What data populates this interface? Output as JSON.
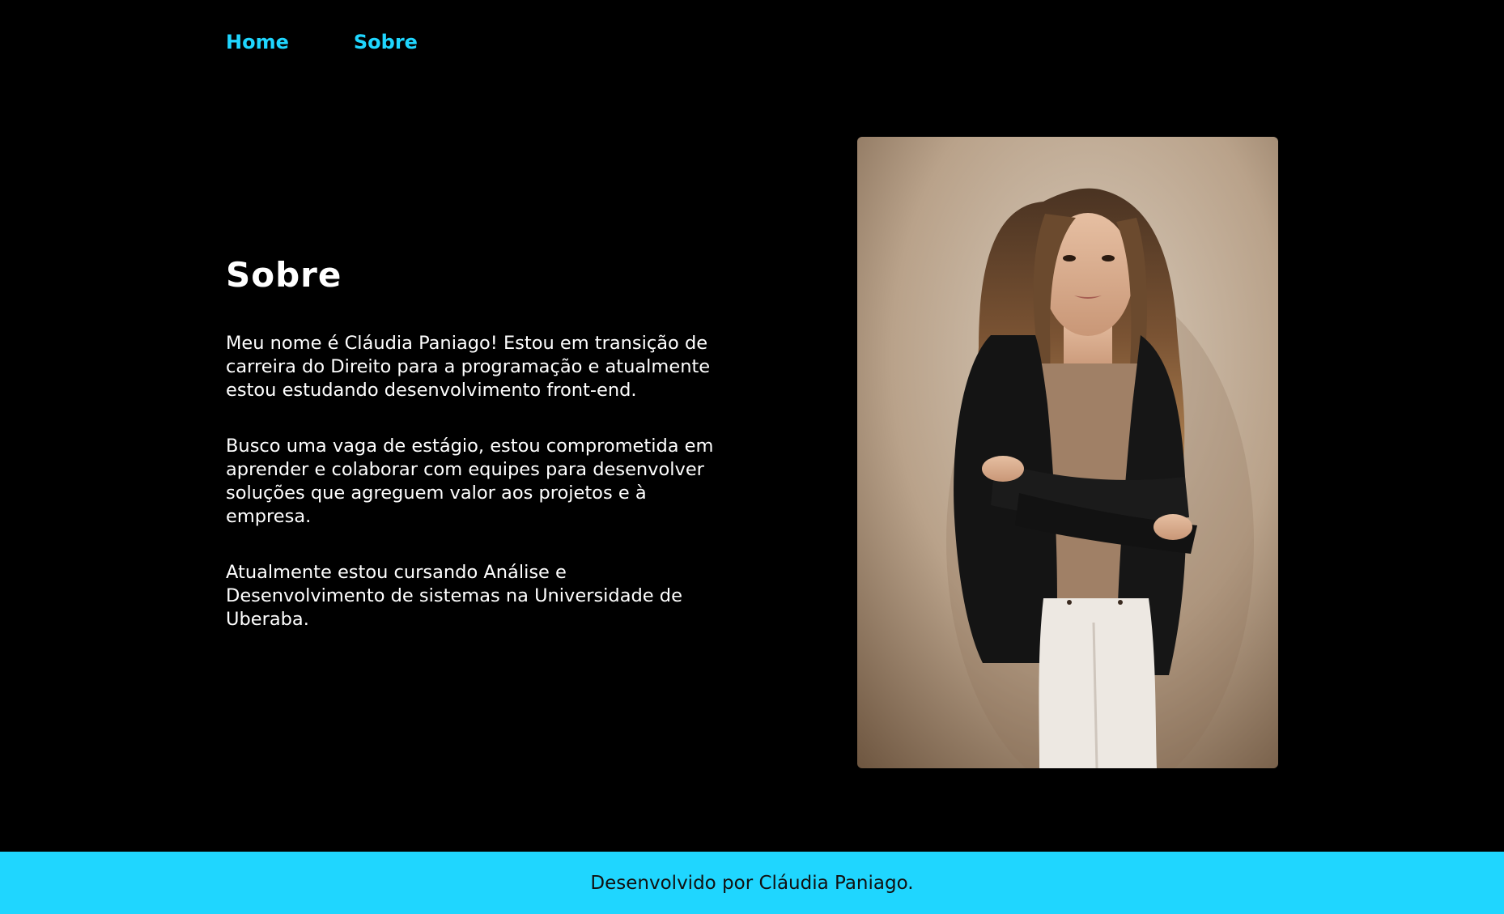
{
  "nav": {
    "home_label": "Home",
    "about_label": "Sobre"
  },
  "about": {
    "title": "Sobre",
    "paragraphs": [
      "Meu nome é Cláudia Paniago! Estou em transição de carreira do Direito para a programação e atualmente estou estudando desenvolvimento front-end.",
      "Busco uma vaga de estágio, estou comprometida em aprender e colaborar com equipes para desenvolver soluções que agreguem valor aos projetos e à empresa.",
      "Atualmente estou cursando Análise e Desenvolvimento de sistemas na Universidade de Uberaba."
    ]
  },
  "footer": {
    "text": "Desenvolvido por Cláudia Paniago."
  },
  "colors": {
    "background": "#000000",
    "accent": "#1fd6ff",
    "text": "#ffffff",
    "footer_text": "#111111"
  }
}
